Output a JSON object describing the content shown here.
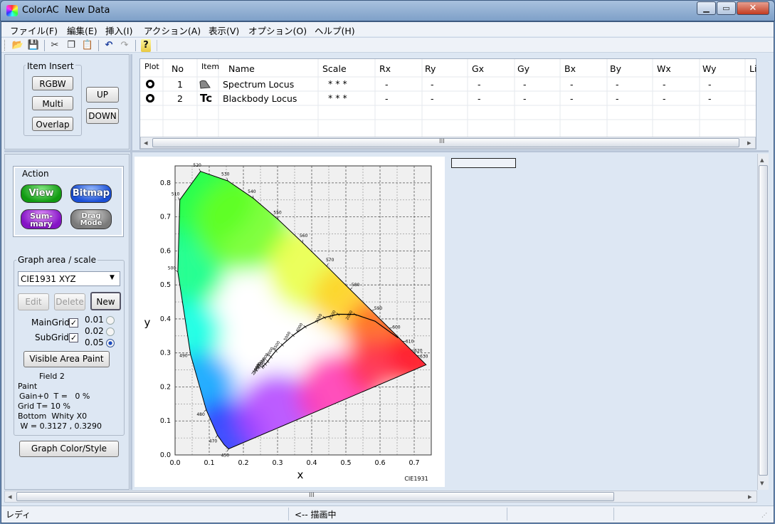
{
  "window": {
    "title": "ColorAC  New Data",
    "minimize": "▁",
    "maximize": "▭",
    "close": "✕"
  },
  "menu": [
    "ファイル(F)",
    "編集(E)",
    "挿入(I)",
    "アクション(A)",
    "表示(V)",
    "オプション(O)",
    "ヘルプ(H)"
  ],
  "toolbar": [
    {
      "name": "open-folder-icon",
      "glyph": "📂"
    },
    {
      "name": "save-icon",
      "glyph": "💾"
    },
    {
      "name": "cut-icon",
      "glyph": "✂"
    },
    {
      "name": "copy-icon",
      "glyph": "❐"
    },
    {
      "name": "paste-icon",
      "glyph": "📋"
    },
    {
      "name": "undo-icon",
      "glyph": "↶"
    },
    {
      "name": "redo-icon",
      "glyph": "↷"
    },
    {
      "name": "help-icon",
      "glyph": "?"
    }
  ],
  "item_insert": {
    "title": "Item Insert",
    "rgbw": "RGBW",
    "multi": "Multi",
    "overlap": "Overlap",
    "up": "UP",
    "down": "DOWN"
  },
  "table": {
    "columns": [
      {
        "label": "Plot",
        "sub": "lot"
      },
      {
        "label": "No"
      },
      {
        "label": "Item"
      },
      {
        "label": "Name"
      },
      {
        "label": "Scale"
      },
      {
        "label": "Rx"
      },
      {
        "label": "Ry"
      },
      {
        "label": "Gx"
      },
      {
        "label": "Gy"
      },
      {
        "label": "Bx"
      },
      {
        "label": "By"
      },
      {
        "label": "Wx"
      },
      {
        "label": "Wy"
      },
      {
        "label": "Li"
      }
    ],
    "rows": [
      {
        "plot": "O",
        "no": "1",
        "item_icon": "spectrum-locus-icon",
        "name": "Spectrum Locus",
        "scale": "* * *",
        "rx": "-",
        "ry": "-",
        "gx": "-",
        "gy": "-",
        "bx": "-",
        "by": "-",
        "wx": "-",
        "wy": "-"
      },
      {
        "plot": "O",
        "no": "2",
        "item_icon": "Tc",
        "name": "Blackbody Locus",
        "scale": "* * *",
        "rx": "-",
        "ry": "-",
        "gx": "-",
        "gy": "-",
        "bx": "-",
        "by": "-",
        "wx": "-",
        "wy": "-"
      }
    ],
    "scroll_grip": "III"
  },
  "action": {
    "title": "Action",
    "view": "View",
    "bitmap": "Bitmap",
    "summary_1": "Sum-",
    "summary_2": "mary",
    "drag_1": "Drag",
    "drag_2": "Mode"
  },
  "graph_area": {
    "title": "Graph area / scale",
    "selected": "CIE1931 XYZ",
    "edit": "Edit",
    "delete": "Delete",
    "new": "New",
    "main_grid": "MainGrid",
    "sub_grid": "SubGrid",
    "grid_options": [
      "0.01",
      "0.02",
      "0.05"
    ],
    "selected_grid": "0.05",
    "visible_area_paint": "Visible Area Paint",
    "info": [
      "Field 2",
      "Paint",
      "Gain+0  T =   0 %",
      "Grid T= 10 %",
      "Bottom  Whity X0",
      " W = 0.3127 , 0.3290"
    ]
  },
  "graph_color_style": "Graph Color/Style",
  "chart_data": {
    "type": "scatter",
    "title": "",
    "xlabel": "x",
    "ylabel": "y",
    "corner_label": "CIE1931",
    "xlim": [
      0,
      0.75
    ],
    "ylim": [
      0,
      0.85
    ],
    "x_ticks": [
      "0.0",
      "0.1",
      "0.2",
      "0.3",
      "0.4",
      "0.5",
      "0.6",
      "0.7"
    ],
    "y_ticks": [
      "0.0",
      "0.1",
      "0.2",
      "0.3",
      "0.4",
      "0.5",
      "0.6",
      "0.7",
      "0.8"
    ],
    "grid": true,
    "spectrum_locus": [
      {
        "nm": "450",
        "x": 0.1566,
        "y": 0.0177
      },
      {
        "nm": "460",
        "x": 0.144,
        "y": 0.0297
      },
      {
        "nm": "470",
        "x": 0.1241,
        "y": 0.0578
      },
      {
        "nm": "480",
        "x": 0.0913,
        "y": 0.1327
      },
      {
        "nm": "490",
        "x": 0.0454,
        "y": 0.295
      },
      {
        "nm": "500",
        "x": 0.0082,
        "y": 0.5384
      },
      {
        "nm": "510",
        "x": 0.0139,
        "y": 0.7502
      },
      {
        "nm": "520",
        "x": 0.0743,
        "y": 0.8338
      },
      {
        "nm": "530",
        "x": 0.1547,
        "y": 0.8059
      },
      {
        "nm": "540",
        "x": 0.2296,
        "y": 0.7543
      },
      {
        "nm": "550",
        "x": 0.3016,
        "y": 0.6923
      },
      {
        "nm": "560",
        "x": 0.3731,
        "y": 0.6245
      },
      {
        "nm": "570",
        "x": 0.4441,
        "y": 0.5547
      },
      {
        "nm": "580",
        "x": 0.5125,
        "y": 0.4866
      },
      {
        "nm": "590",
        "x": 0.5752,
        "y": 0.4242
      },
      {
        "nm": "600",
        "x": 0.627,
        "y": 0.3725
      },
      {
        "nm": "610",
        "x": 0.6658,
        "y": 0.334
      },
      {
        "nm": "620",
        "x": 0.6915,
        "y": 0.3083
      },
      {
        "nm": "630",
        "x": 0.7079,
        "y": 0.292
      },
      {
        "nm": "700",
        "x": 0.7347,
        "y": 0.2653
      }
    ],
    "blackbody_locus": [
      {
        "T": "25000",
        "x": 0.2548,
        "y": 0.2574
      },
      {
        "T": "20000",
        "x": 0.258,
        "y": 0.2615
      },
      {
        "T": "15000",
        "x": 0.264,
        "y": 0.267
      },
      {
        "T": "12000",
        "x": 0.2713,
        "y": 0.2752
      },
      {
        "T": "10000",
        "x": 0.2806,
        "y": 0.2883
      },
      {
        "T": "8000",
        "x": 0.295,
        "y": 0.3058
      },
      {
        "T": "6500",
        "x": 0.3135,
        "y": 0.3237
      },
      {
        "T": "5000",
        "x": 0.3451,
        "y": 0.3516
      },
      {
        "T": "4000",
        "x": 0.3805,
        "y": 0.3768
      },
      {
        "T": "3000",
        "x": 0.4369,
        "y": 0.4041
      },
      {
        "T": "2500",
        "x": 0.477,
        "y": 0.4137
      },
      {
        "T": "2000",
        "x": 0.5267,
        "y": 0.4133
      },
      {
        "T": "1500",
        "x": 0.5857,
        "y": 0.3931
      },
      {
        "T": "1000",
        "x": 0.6528,
        "y": 0.3444
      }
    ],
    "blackbody_tick_labels": [
      "2000",
      "2500",
      "3000",
      "4000",
      "5000",
      "6500",
      "8000",
      "10000",
      "12000",
      "15000",
      "20000",
      "25000"
    ]
  },
  "status": {
    "left": "レディ",
    "middle": "<-- 描画中"
  }
}
